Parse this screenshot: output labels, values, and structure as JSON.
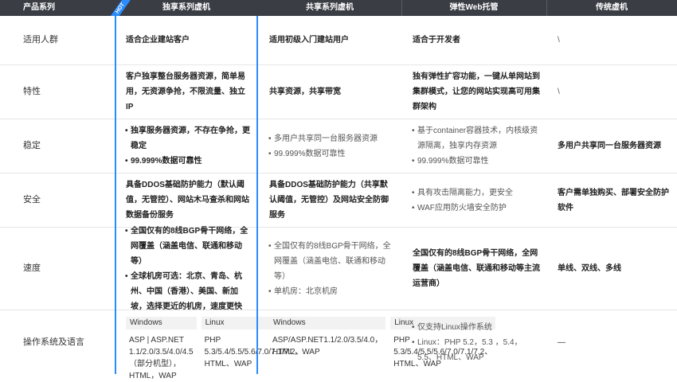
{
  "header": {
    "col0": "产品系列",
    "col1": "独享系列虚机",
    "col2": "共享系列虚机",
    "col3": "弹性Web托管",
    "col4": "传统虚机",
    "badge": "HOT"
  },
  "rows": {
    "audience": {
      "label": "适用人群",
      "col1": "适合企业建站客户",
      "col2": "适用初级入门建站用户",
      "col3": "适合于开发者",
      "col4": "\\"
    },
    "features": {
      "label": "特性",
      "col1": "客户独享整台服务器资源，简单易用，无资源争抢，不限流量、独立IP",
      "col2": "共享资源，共享带宽",
      "col3": "独有弹性扩容功能，一键从单网站到集群模式，让您的网站实现高可用集群架构",
      "col4": "\\"
    },
    "stability": {
      "label": "稳定",
      "col1": [
        "独享服务器资源，不存在争抢，更稳定",
        "99.999%数据可靠性"
      ],
      "col2": [
        "多用户共享同一台服务器资源",
        "99.999%数据可靠性"
      ],
      "col3": [
        "基于container容器技术，内核级资源隔离，独享内存资源",
        "99.999%数据可靠性"
      ],
      "col4": "多用户共享同一台服务器资源"
    },
    "security": {
      "label": "安全",
      "col1": "具备DDOS基础防护能力（默认阈值，无管控）、网站木马查杀和网站数据备份服务",
      "col2": "具备DDOS基础防护能力（共享默认阈值，无管控）及网站安全防御服务",
      "col3": [
        "具有攻击隔离能力，更安全",
        "WAF应用防火墙安全防护"
      ],
      "col4": "客户需单独购买、部署安全防护软件"
    },
    "speed": {
      "label": "速度",
      "col1": [
        "全国仅有的8线BGP骨干网络，全网覆盖（涵盖电信、联通和移动等）",
        "全球机房可选：北京、青岛、杭州、中国（香港）、美国、新加坡，选择更近的机房，速度更快"
      ],
      "col2": [
        "全国仅有的8线BGP骨干网络，全网覆盖（涵盖电信、联通和移动等）",
        "单机房：北京机房"
      ],
      "col3": "全国仅有的8线BGP骨干网络，全网覆盖（涵盖电信、联通和移动等主流运营商）",
      "col4": "单线、双线、多线"
    },
    "os": {
      "label": "操作系统及语言",
      "col1": {
        "windows_h": "Windows",
        "linux_h": "Linux",
        "windows": "ASP | ASP.NET 1.1/2.0/3.5/4.0/4.5（部分机型），HTML，WAP",
        "linux": "PHP 5.3/5.4/5.5/5.6/7.0/7.1/7.2、HTML、WAP"
      },
      "col2": {
        "windows_h": "Windows",
        "linux_h": "Linux",
        "windows": "ASP/ASP.NET1.1/2.0/3.5/4.0，HTML，WAP",
        "linux": "PHP 5.3/5.4/5.5/5.6/7.0/7.1/7.2、HTML、WAP"
      },
      "col3": [
        "仅支持Linux操作系统",
        "Linux：PHP 5.2，5.3 ，5.4， 5.5、HTML、WAP"
      ],
      "col4": "—"
    }
  },
  "colors": {
    "header_bg": "#3a3d44",
    "accent": "#2a8cff",
    "divider": "#e6e6e6"
  }
}
